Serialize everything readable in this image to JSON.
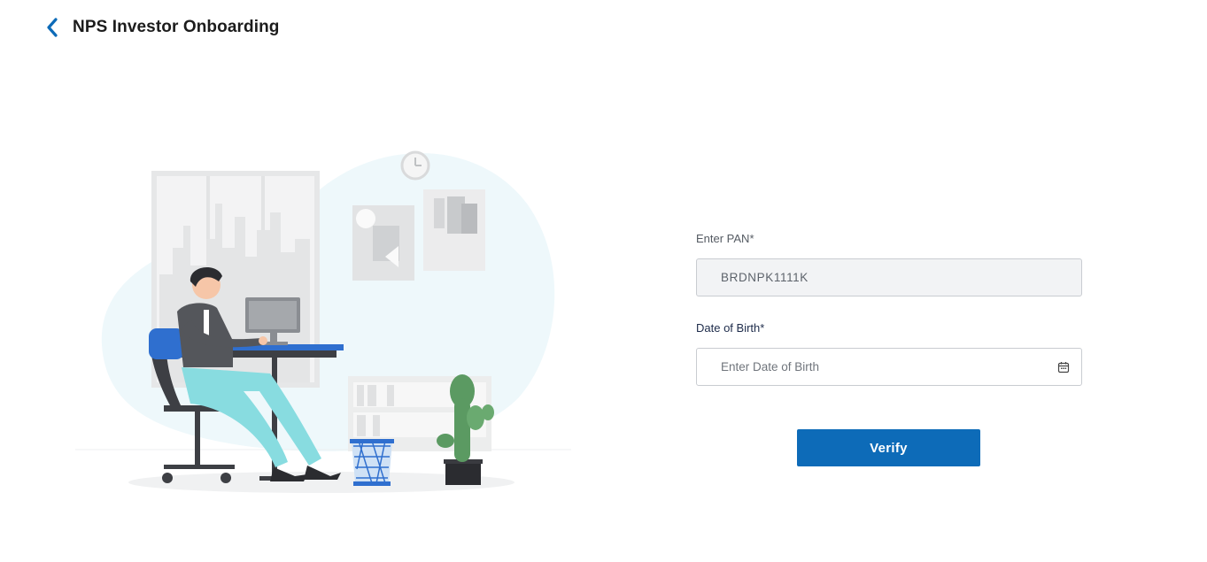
{
  "header": {
    "title": "NPS Investor Onboarding"
  },
  "form": {
    "pan_label": "Enter PAN*",
    "pan_value": "BRDNPK1111K",
    "dob_label": "Date of Birth*",
    "dob_placeholder": "Enter Date of Birth",
    "dob_value": "",
    "verify_label": "Verify"
  },
  "icons": {
    "back": "chevron-left-icon",
    "calendar": "calendar-icon"
  },
  "colors": {
    "accent": "#0d6bb8",
    "back_arrow": "#0d6bb8",
    "disabled_bg": "#f2f3f5"
  }
}
